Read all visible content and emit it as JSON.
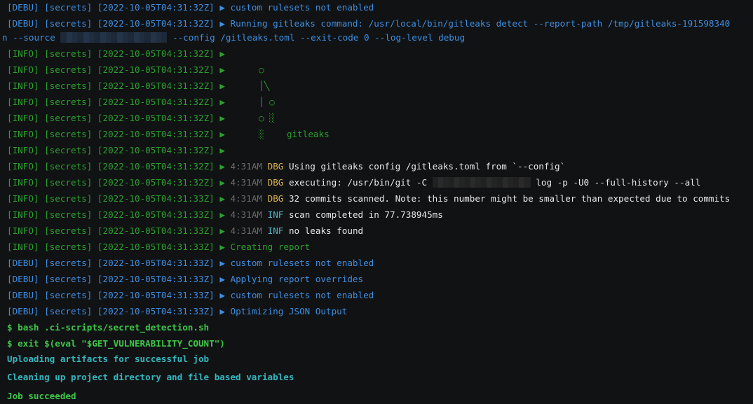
{
  "prefix": {
    "debu": "[DEBU] [secrets]",
    "info": "[INFO] [secrets]",
    "ts32": "[2022-10-05T04:31:32Z]",
    "ts33": "[2022-10-05T04:31:33Z]",
    "arrow": "▶"
  },
  "lines": {
    "l0": "custom rulesets not enabled",
    "l1": "Running gitleaks command: /usr/local/bin/gitleaks detect --report-path /tmp/gitleaks-191598340",
    "l1b_start": "n --source",
    "l1b_end": "--config /gitleaks.toml --exit-code 0 --log-level debug",
    "l7_logo": "gitleaks",
    "log_time": "4:31AM",
    "dbg": "DBG",
    "inf": "INF",
    "l9": "Using gitleaks config /gitleaks.toml from `--config`",
    "l10a": "executing: /usr/bin/git -C",
    "l10b": "log -p -U0 --full-history --all",
    "l11": "32 commits scanned. Note: this number might be smaller than expected due to commits",
    "l12": "scan completed in 77.738945ms",
    "l13": "no leaks found",
    "l14": "Creating report",
    "l15": "custom rulesets not enabled",
    "l16": "Applying report overrides",
    "l17": "custom rulesets not enabled",
    "l18": "Optimizing JSON Output",
    "cmd1": "$ bash .ci-scripts/secret_detection.sh",
    "cmd2": "$ exit $(eval \"$GET_VULNERABILITY_COUNT\")",
    "upload": "Uploading artifacts for successful job",
    "cleanup": "Cleaning up project directory and file based variables",
    "success": "Job succeeded"
  },
  "logo": {
    "r1": "○",
    "r2": "│╲",
    "r3": "│ ○",
    "r4": "○ ░",
    "r5": "░"
  }
}
